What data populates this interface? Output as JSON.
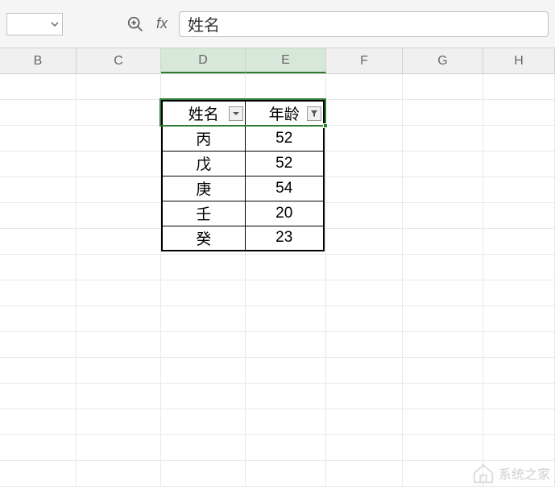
{
  "formula_bar": {
    "fx_label": "fx",
    "value": "姓名"
  },
  "columns": [
    "B",
    "C",
    "D",
    "E",
    "F",
    "G",
    "H"
  ],
  "selected_columns": [
    "D",
    "E"
  ],
  "table": {
    "headers": {
      "name": "姓名",
      "age": "年龄"
    },
    "rows": [
      {
        "name": "丙",
        "age": "52"
      },
      {
        "name": "戊",
        "age": "52"
      },
      {
        "name": "庚",
        "age": "54"
      },
      {
        "name": "壬",
        "age": "20"
      },
      {
        "name": "癸",
        "age": "23"
      }
    ]
  },
  "watermark": {
    "text": "系统之家"
  }
}
